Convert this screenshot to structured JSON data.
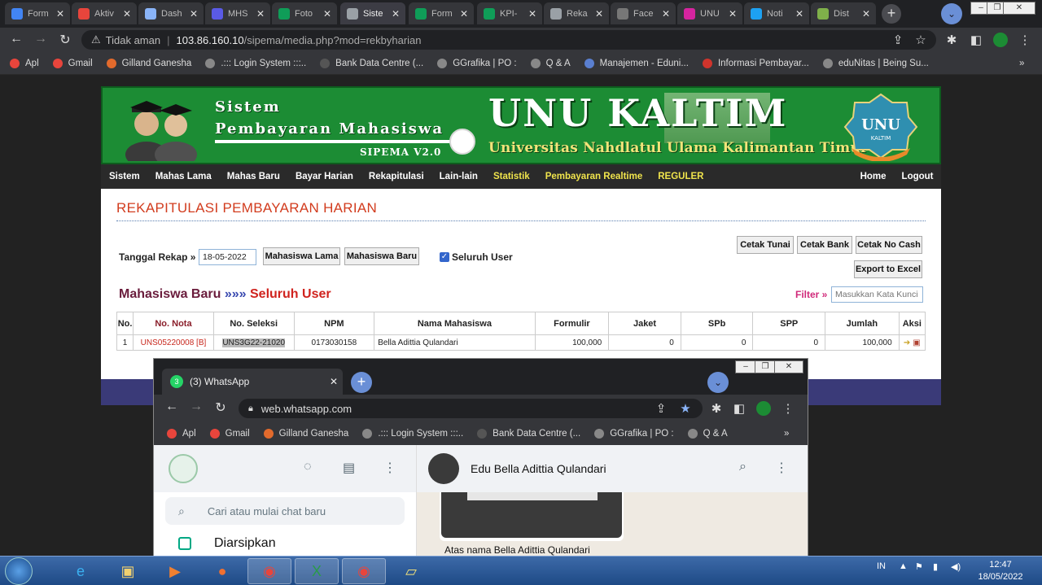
{
  "browser": {
    "tabs": [
      {
        "label": "Form",
        "icon": "google-drive-icon",
        "color": "#4285f4"
      },
      {
        "label": "Aktiv",
        "icon": "chrome-web-icon",
        "color": "#e8453c"
      },
      {
        "label": "Dash",
        "icon": "dashboard-icon",
        "color": "#8ab4f8"
      },
      {
        "label": "MHS",
        "icon": "c-app-icon",
        "color": "#5a5ae6"
      },
      {
        "label": "Foto",
        "icon": "sheets-icon",
        "color": "#0f9d58"
      },
      {
        "label": "Siste",
        "icon": "globe-icon",
        "color": "#9aa0a6"
      },
      {
        "label": "Form",
        "icon": "sheets-icon",
        "color": "#0f9d58"
      },
      {
        "label": "KPI-",
        "icon": "sheets-icon",
        "color": "#0f9d58"
      },
      {
        "label": "Reka",
        "icon": "globe-icon",
        "color": "#9aa0a6"
      },
      {
        "label": "Face",
        "icon": "incognito-icon",
        "color": "#777"
      },
      {
        "label": "UNU",
        "icon": "instagram-icon",
        "color": "#d6249f"
      },
      {
        "label": "Noti",
        "icon": "twitter-icon",
        "color": "#1da1f2"
      },
      {
        "label": "Dist",
        "icon": "unu-logo-icon",
        "color": "#7fb04a"
      }
    ],
    "new_tab": "+",
    "url_warning": "Tidak aman",
    "url_host": "103.86.160.10",
    "url_path": "/sipema/media.php?mod=rekbyharian",
    "bookmarks": [
      {
        "label": "Apl",
        "color": "#e8453c"
      },
      {
        "label": "Gmail",
        "color": "#e8453c"
      },
      {
        "label": "Gilland Ganesha",
        "color": "#e26a2c"
      },
      {
        "label": ".::: Login System :::..",
        "color": "#888"
      },
      {
        "label": "Bank Data Centre (...",
        "color": "#555"
      },
      {
        "label": "GGrafika | PO :",
        "color": "#888"
      },
      {
        "label": "Q & A",
        "color": "#888"
      },
      {
        "label": "Manajemen - Eduni...",
        "color": "#5a7fd0"
      },
      {
        "label": "Informasi Pembayar...",
        "color": "#d0342c"
      },
      {
        "label": "eduNitas | Being Su...",
        "color": "#888"
      }
    ],
    "bookmarks_more": "»"
  },
  "header": {
    "system_line1": "Sistem",
    "system_line2": "Pembayaran Mahasiswa",
    "version": "SIPEMA V2.0",
    "brand": "UNU KALTIM",
    "university": "Universitas Nahdlatul Ulama Kalimantan Timur",
    "logo_text": "UNU",
    "logo_sub": "KALTIM"
  },
  "menu": {
    "left": [
      "Sistem",
      "Mahas Lama",
      "Mahas Baru",
      "Bayar Harian",
      "Rekapitulasi",
      "Lain-lain"
    ],
    "highlight": [
      "Statistik",
      "Pembayaran Realtime",
      "REGULER"
    ],
    "right": [
      "Home",
      "Logout"
    ]
  },
  "rekap": {
    "title": "REKAPITULASI PEMBAYARAN HARIAN",
    "date_label": "Tanggal Rekap »",
    "date_value": "18-05-2022",
    "btn_lama": "Mahasiswa Lama",
    "btn_baru": "Mahasiswa Baru",
    "checkbox_label": "Seluruh User",
    "btn_tunai": "Cetak Tunai",
    "btn_bank": "Cetak Bank",
    "btn_nocash": "Cetak No Cash",
    "btn_excel": "Export to Excel",
    "section_a": "Mahasiswa Baru",
    "section_arrows": "»»»",
    "section_b": "Seluruh User",
    "filter_label": "Filter »",
    "filter_placeholder": "Masukkan Kata Kunci"
  },
  "table": {
    "columns": [
      "No.",
      "No. Nota",
      "No. Seleksi",
      "NPM",
      "Nama Mahasiswa",
      "Formulir",
      "Jaket",
      "SPb",
      "SPP",
      "Jumlah",
      "Aksi"
    ],
    "rows": [
      {
        "no": "1",
        "nota": "UNS05220008 [B]",
        "seleksi": "UNS3G22-21020",
        "npm": "0173030158",
        "nama": "Bella Adittia Qulandari",
        "formulir": "100,000",
        "jaket": "0",
        "spb": "0",
        "spp": "0",
        "jumlah": "100,000"
      }
    ]
  },
  "whatsapp": {
    "tab_badge": "3",
    "tab_title": "(3) WhatsApp",
    "url": "web.whatsapp.com",
    "bookmarks": [
      "Apl",
      "Gmail",
      "Gilland Ganesha",
      ".::: Login System :::..",
      "Bank Data Centre (...",
      "GGrafika | PO :",
      "Q & A"
    ],
    "search_placeholder": "Cari atau mulai chat baru",
    "archived": "Diarsipkan",
    "contact": "Edu Bella Adittia Qulandari",
    "message_caption": "Atas nama Bella Adittia Qulandari"
  },
  "taskbar": {
    "lang": "IN",
    "time": "12:47",
    "date": "18/05/2022"
  }
}
